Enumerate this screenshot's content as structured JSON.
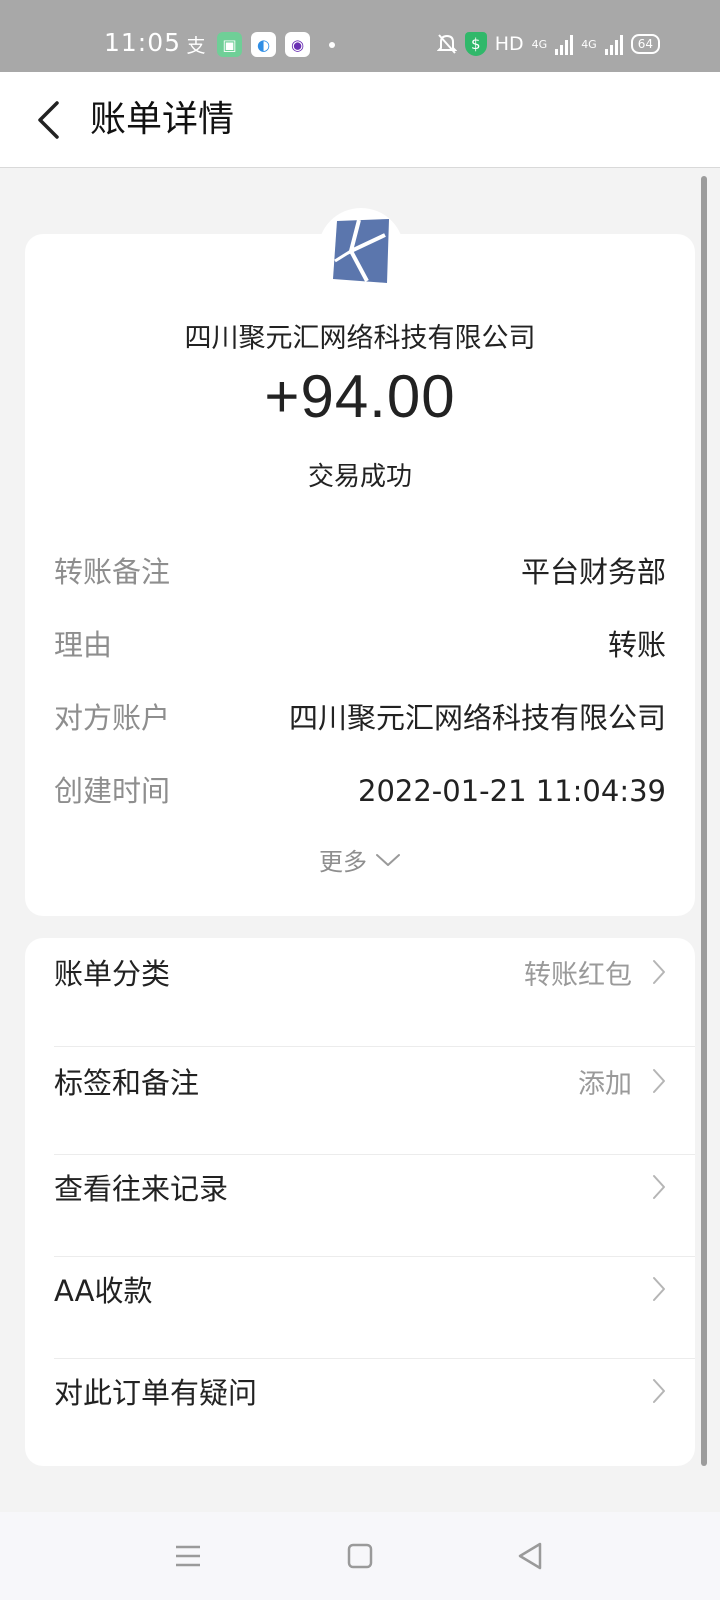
{
  "status_bar": {
    "time": "11:05",
    "network_label": "HD",
    "signal_1": "4G",
    "signal_2": "4G",
    "battery": "64"
  },
  "header": {
    "title": "账单详情",
    "back_icon": "chevron-left-icon"
  },
  "summary": {
    "merchant_name": "四川聚元汇网络科技有限公司",
    "amount": "+94.00",
    "status": "交易成功"
  },
  "details": [
    {
      "label": "转账备注",
      "value": "平台财务部"
    },
    {
      "label": "理由",
      "value": "转账"
    },
    {
      "label": "对方账户",
      "value": "四川聚元汇网络科技有限公司"
    },
    {
      "label": "创建时间",
      "value": "2022-01-21 11:04:39"
    }
  ],
  "more_label": "更多",
  "menu": [
    {
      "label": "账单分类",
      "value": "转账红包"
    },
    {
      "label": "标签和备注",
      "value": "添加"
    },
    {
      "label": "查看往来记录",
      "value": ""
    },
    {
      "label": "AA收款",
      "value": ""
    },
    {
      "label": "对此订单有疑问",
      "value": ""
    }
  ],
  "colors": {
    "logo_blue": "#5b76ad",
    "status_bar": "#a8a8a8",
    "accent_gray": "#8e8e8e"
  }
}
